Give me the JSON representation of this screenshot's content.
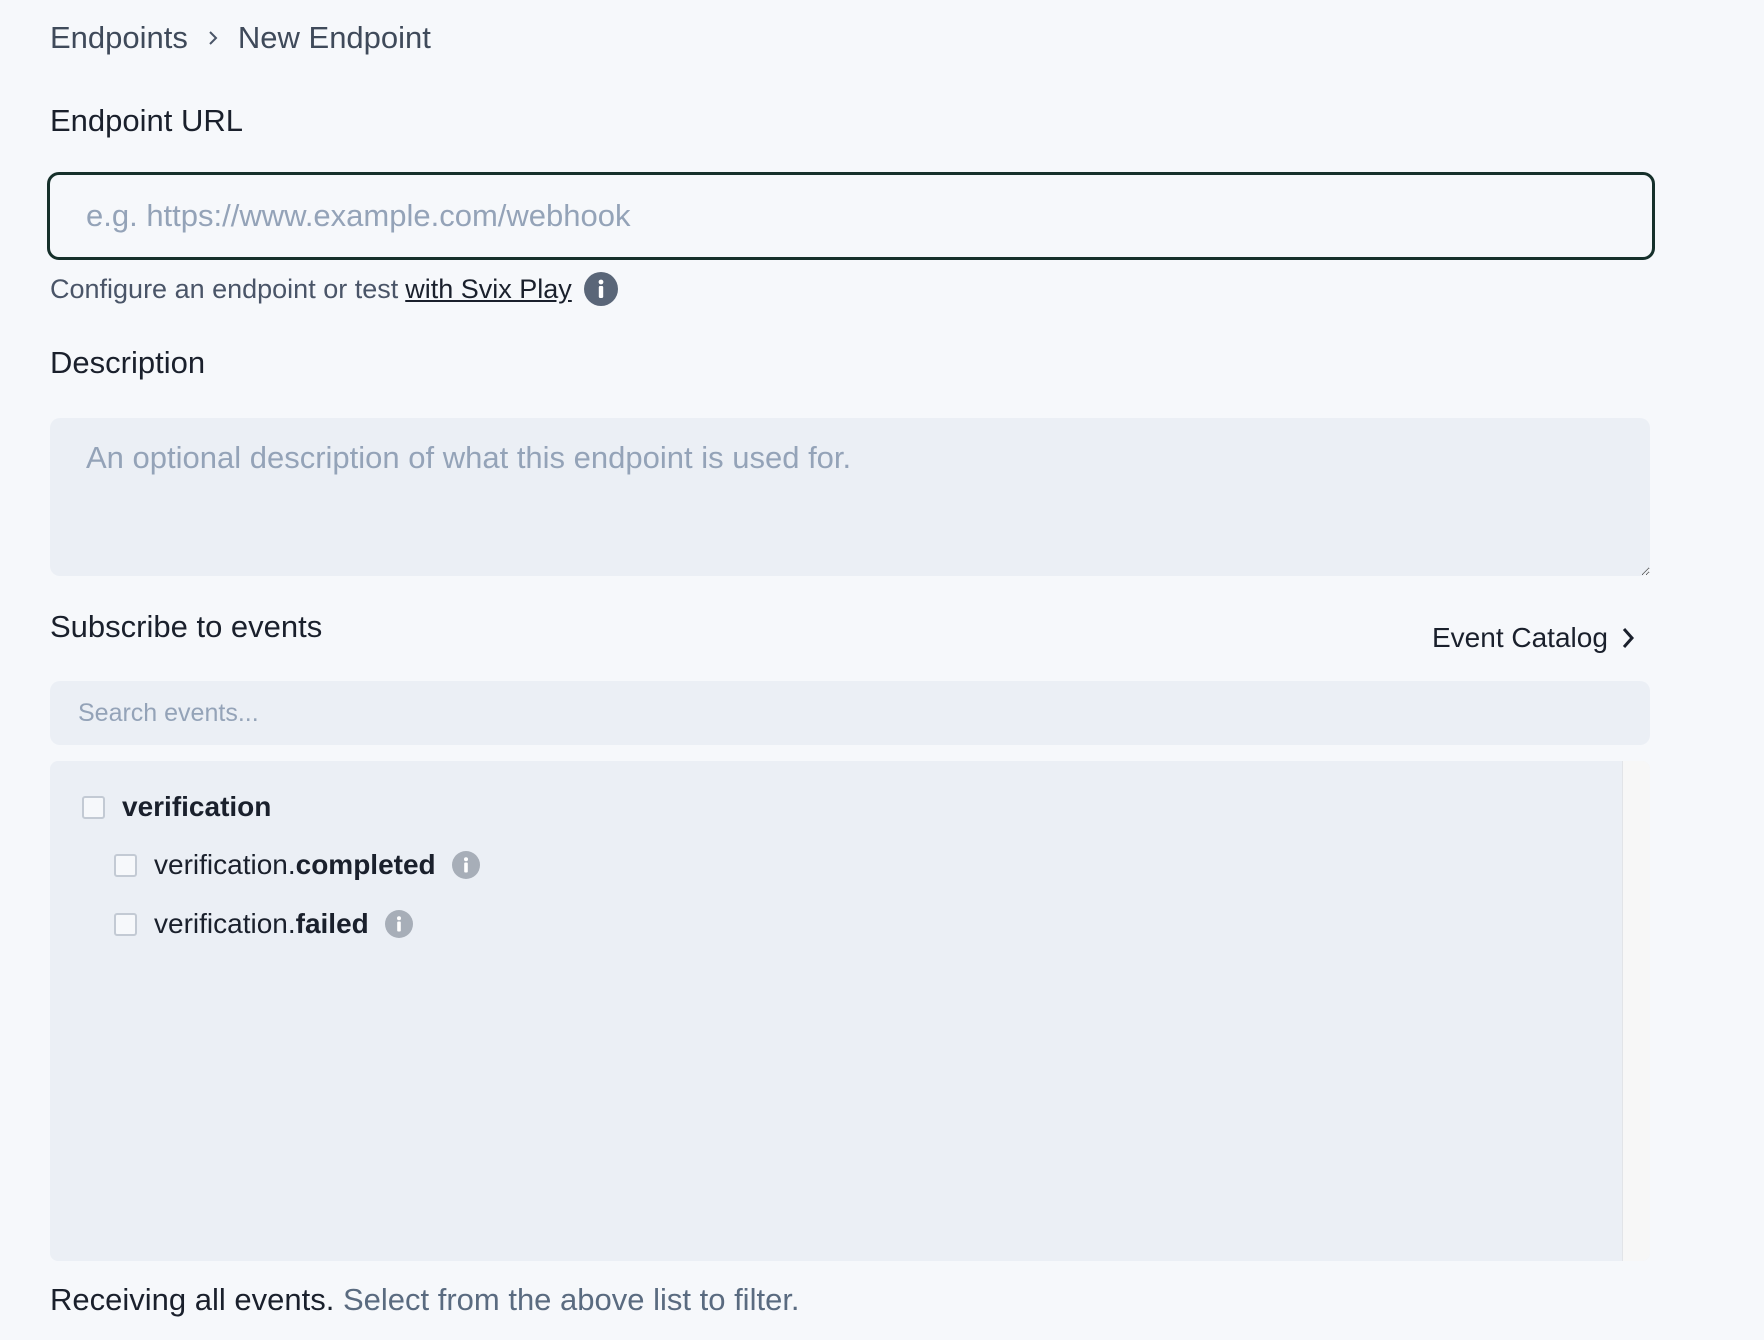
{
  "breadcrumb": {
    "parent": "Endpoints",
    "separator_icon": "chevron-right-icon",
    "current": "New Endpoint"
  },
  "endpoint_url": {
    "label": "Endpoint URL",
    "value": "",
    "placeholder": "e.g. https://www.example.com/webhook",
    "helper_text": "Configure an endpoint or test",
    "helper_link": "with Svix Play",
    "info_icon": "info-icon"
  },
  "description": {
    "label": "Description",
    "value": "",
    "placeholder": "An optional description of what this endpoint is used for."
  },
  "subscribe": {
    "label": "Subscribe to events",
    "catalog_link": "Event Catalog",
    "catalog_icon": "chevron-right-icon",
    "search_placeholder": "Search events...",
    "groups": [
      {
        "name": "verification",
        "checked": false,
        "events": [
          {
            "prefix": "verification.",
            "suffix": "completed",
            "checked": false
          },
          {
            "prefix": "verification.",
            "suffix": "failed",
            "checked": false
          }
        ]
      }
    ]
  },
  "footer": {
    "status": "Receiving all events.",
    "hint": " Select from the above list to filter."
  },
  "colors": {
    "background": "#f6f8fb",
    "input_fill": "#ebeff5",
    "focus_border": "#16302b",
    "text": "#1a202c",
    "muted": "#5a6b80",
    "placeholder": "#94a3b8"
  }
}
